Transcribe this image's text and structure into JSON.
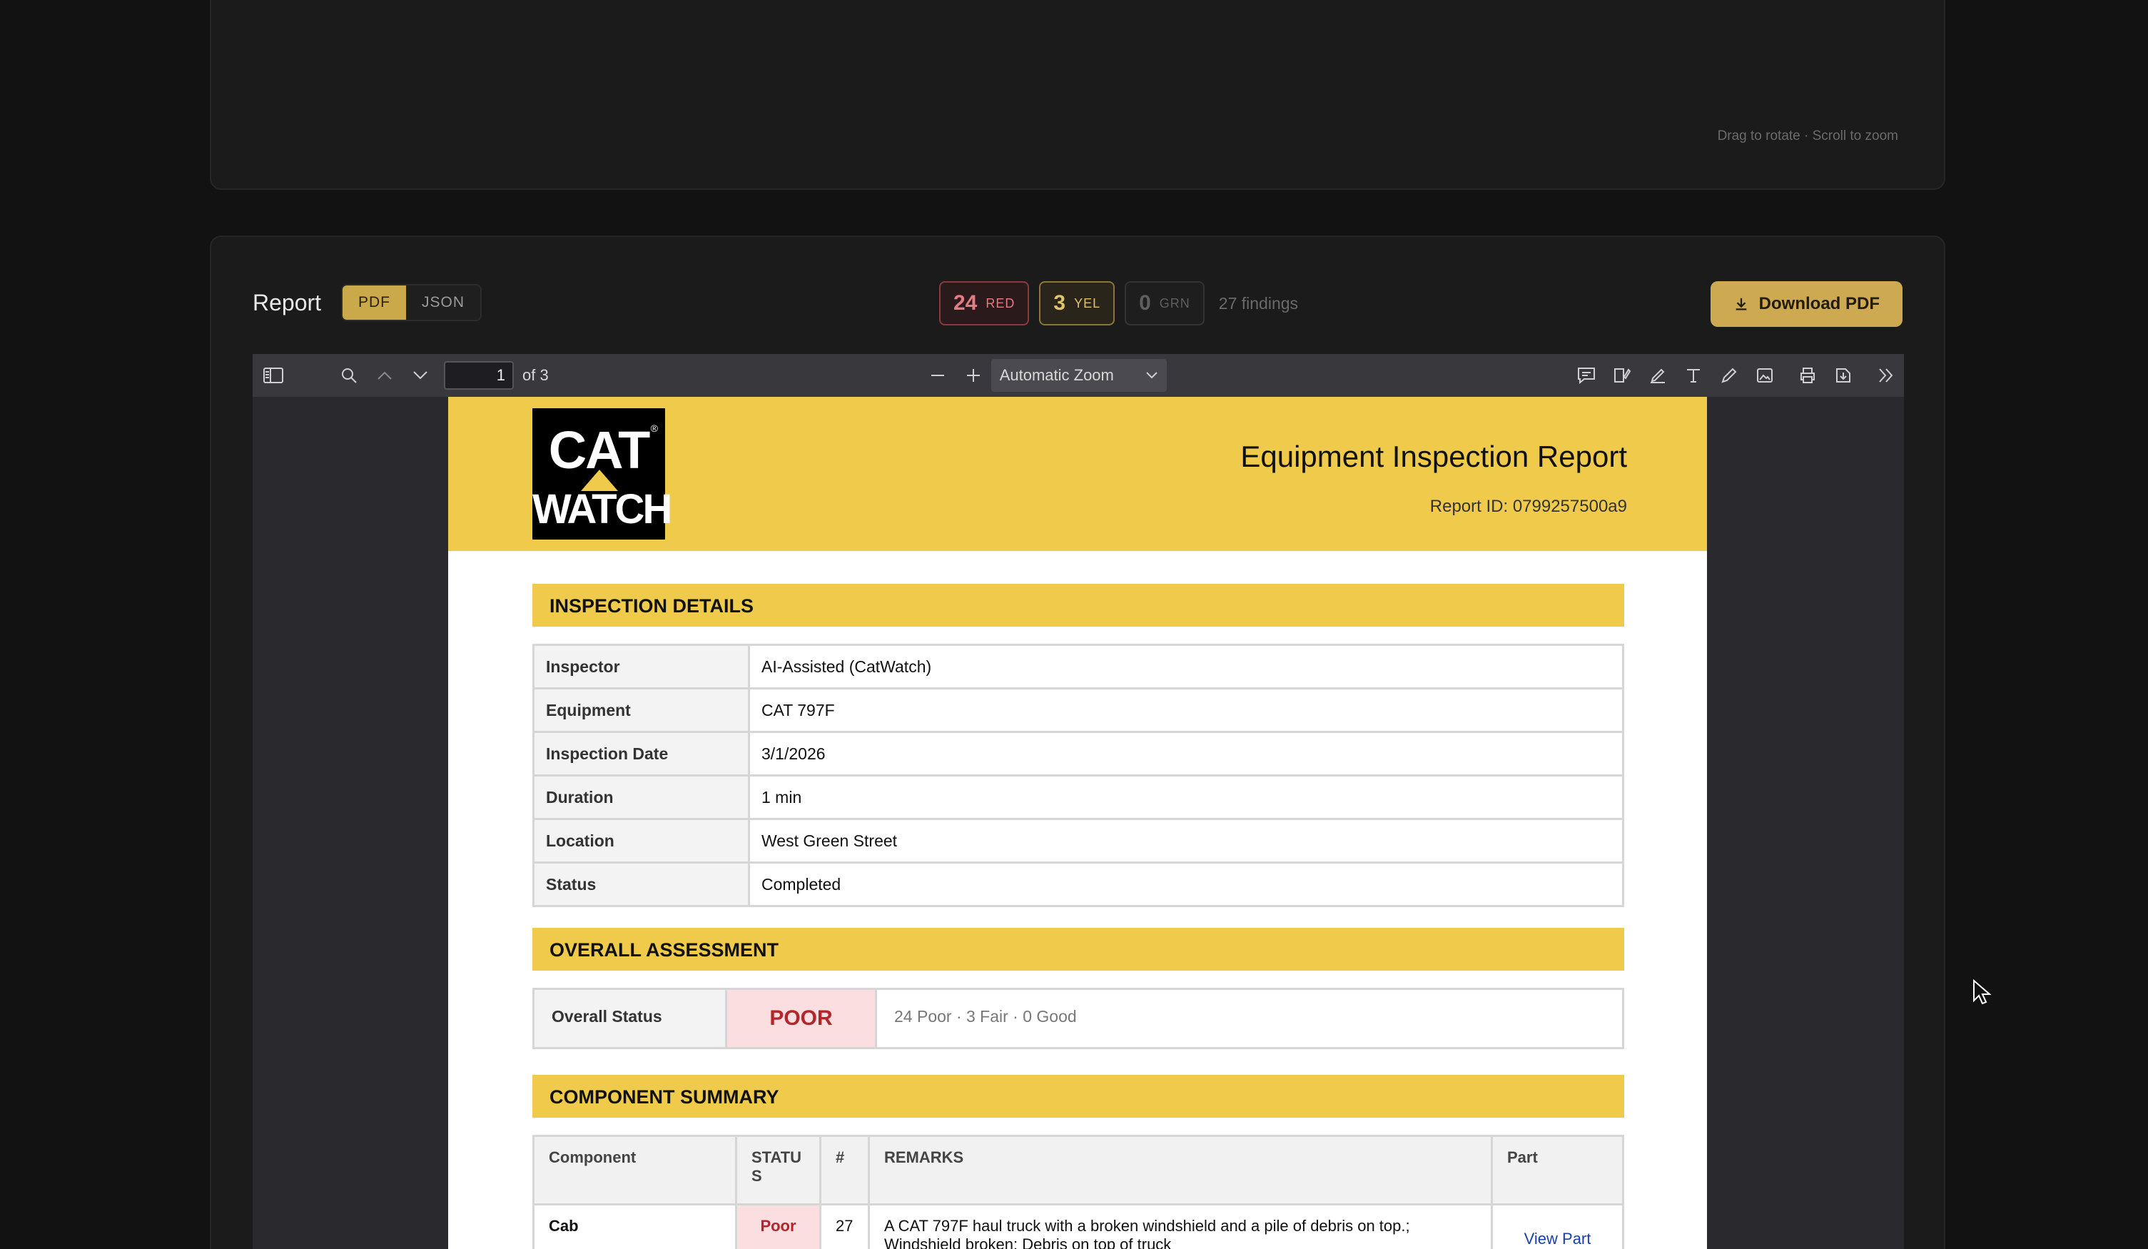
{
  "viewer": {
    "hint": "Drag to rotate · Scroll to zoom"
  },
  "report": {
    "title": "Report",
    "tabs": [
      "PDF",
      "JSON"
    ],
    "counts": {
      "red": {
        "num": "24",
        "label": "RED"
      },
      "yel": {
        "num": "3",
        "label": "YEL"
      },
      "grn": {
        "num": "0",
        "label": "GRN"
      },
      "findings": "27 findings"
    },
    "download_label": "Download PDF"
  },
  "toolbar": {
    "page_value": "1",
    "page_of": "of 3",
    "zoom": "Automatic Zoom"
  },
  "document": {
    "logo_top": "CAT",
    "logo_bottom": "WATCH",
    "title": "Equipment Inspection Report",
    "report_id": "Report ID: 0799257500a9",
    "sections": {
      "details": "INSPECTION DETAILS",
      "assessment": "OVERALL ASSESSMENT",
      "components": "COMPONENT SUMMARY"
    },
    "details": [
      {
        "key": "Inspector",
        "value": "AI-Assisted (CatWatch)"
      },
      {
        "key": "Equipment",
        "value": "CAT 797F"
      },
      {
        "key": "Inspection Date",
        "value": "3/1/2026"
      },
      {
        "key": "Duration",
        "value": "1 min"
      },
      {
        "key": "Location",
        "value": "West Green Street"
      },
      {
        "key": "Status",
        "value": "Completed"
      }
    ],
    "assessment": {
      "key": "Overall Status",
      "status": "POOR",
      "summary": "24 Poor  ·  3 Fair  ·  0 Good"
    },
    "component_headers": [
      "Component",
      "STATUS",
      "#",
      "REMARKS",
      "Part"
    ],
    "components": [
      {
        "name": "Cab",
        "status": "Poor",
        "count": "27",
        "remarks": "A CAT 797F haul truck with a broken windshield and a pile of debris on top.; Windshield broken; Debris on top of truck",
        "part": "View Part"
      }
    ]
  }
}
